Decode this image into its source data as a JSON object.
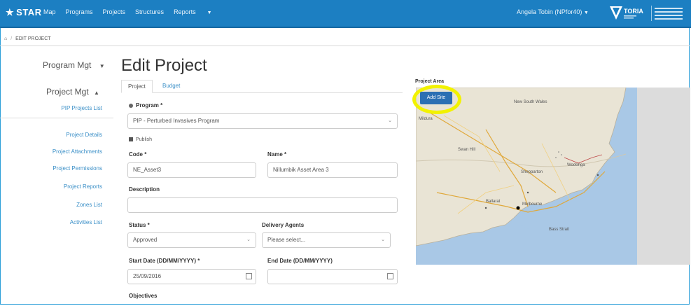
{
  "header": {
    "brand": "STAR",
    "nav": [
      {
        "label": "Map"
      },
      {
        "label": "Programs"
      },
      {
        "label": "Projects"
      },
      {
        "label": "Structures"
      },
      {
        "label": "Reports"
      }
    ],
    "user": "Angela Tobin (NPfor40)"
  },
  "breadcrumb": {
    "home": "⌂",
    "current": "EDIT PROJECT"
  },
  "sidebar": {
    "program_mgt": "Program Mgt",
    "project_mgt": "Project Mgt",
    "pip_projects_list": "PIP Projects List",
    "items": [
      {
        "label": "Project Details"
      },
      {
        "label": "Project Attachments"
      },
      {
        "label": "Project Permissions"
      },
      {
        "label": "Project Reports"
      },
      {
        "label": "Zones List"
      },
      {
        "label": "Activities List"
      }
    ]
  },
  "page": {
    "title": "Edit Project",
    "tabs": [
      {
        "label": "Project"
      },
      {
        "label": "Budget"
      }
    ]
  },
  "form": {
    "program_label": "Program *",
    "program_value": "PIP - Perturbed Invasives Program",
    "publish_label": "Publish",
    "code_label": "Code *",
    "code_value": "NE_Asset3",
    "name_label": "Name *",
    "name_value": "Nillumbik Asset Area 3",
    "description_label": "Description",
    "description_value": "",
    "status_label": "Status *",
    "status_value": "Approved",
    "delivery_label": "Delivery Agents",
    "delivery_placeholder": "Please select...",
    "start_label": "Start Date (DD/MM/YYYY) *",
    "start_value": "25/09/2016",
    "end_label": "End Date (DD/MM/YYYY)",
    "end_value": "",
    "objectives_label": "Objectives"
  },
  "map": {
    "title": "Project Area",
    "add_site_label": "Add Site",
    "labels": {
      "nsw": "New South Wales",
      "mildura": "Mildura",
      "swan_hill": "Swan Hill",
      "shepparton": "Shepparton",
      "wodonga": "Wodonga",
      "ballarat": "Ballarat",
      "melbourne": "Melbourne",
      "bass_strait": "Bass Strait"
    }
  },
  "colors": {
    "nav": "#1c7fc2",
    "highlight": "#f2f200",
    "button": "#2b6fb3",
    "sea": "#a9c8e6",
    "land": "#e9e4d5"
  }
}
